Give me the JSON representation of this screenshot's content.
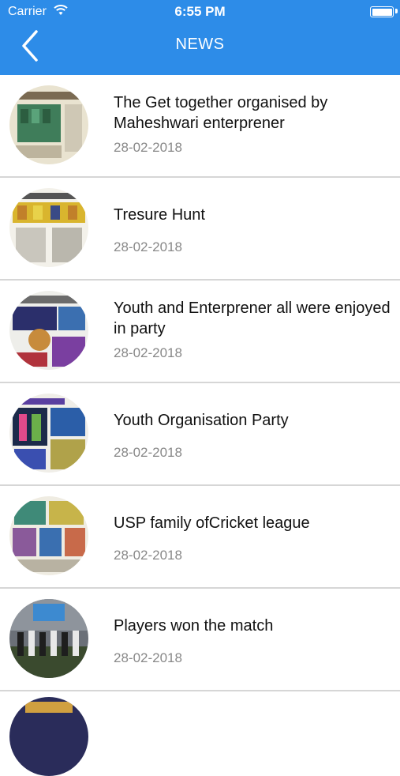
{
  "status_bar": {
    "carrier": "Carrier",
    "time": "6:55 PM"
  },
  "header": {
    "title": "NEWS"
  },
  "colors": {
    "header_bg": "#2d8ce8",
    "date_text": "#888888"
  },
  "news": [
    {
      "title": "The Get together organised by Maheshwari enterprener",
      "date": "28-02-2018"
    },
    {
      "title": "Tresure Hunt",
      "date": "28-02-2018"
    },
    {
      "title": "Youth and Enterprener all were enjoyed in party",
      "date": "28-02-2018"
    },
    {
      "title": "Youth Organisation Party",
      "date": "28-02-2018"
    },
    {
      "title": "USP family ofCricket league",
      "date": "28-02-2018"
    },
    {
      "title": "Players won the match",
      "date": "28-02-2018"
    }
  ]
}
